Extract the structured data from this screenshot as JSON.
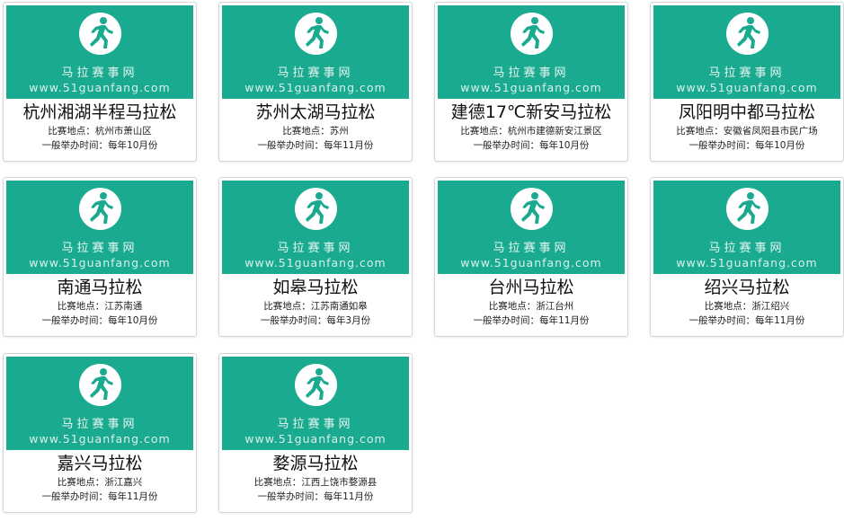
{
  "brand_watermark": "马拉赛事网",
  "brand_url": "www.51guanfang.com",
  "accent_color": "#1aaa90",
  "labels": {
    "location_prefix": "比赛地点：",
    "time_prefix": "一般举办时间：每年"
  },
  "events": [
    {
      "name": "杭州湘湖半程马拉松",
      "location": "杭州市萧山区",
      "month": "10月份"
    },
    {
      "name": "苏州太湖马拉松",
      "location": "苏州",
      "month": "11月份"
    },
    {
      "name": "建德17℃新安马拉松",
      "location": "杭州市建德新安江景区",
      "month": "10月份"
    },
    {
      "name": "凤阳明中都马拉松",
      "location": "安徽省凤阳县市民广场",
      "month": "10月份"
    },
    {
      "name": "南通马拉松",
      "location": "江苏南通",
      "month": "10月份"
    },
    {
      "name": "如皋马拉松",
      "location": "江苏南通如皋",
      "month": "3月份"
    },
    {
      "name": "台州马拉松",
      "location": "浙江台州",
      "month": "11月份"
    },
    {
      "name": "绍兴马拉松",
      "location": "浙江绍兴",
      "month": "11月份"
    },
    {
      "name": "嘉兴马拉松",
      "location": "浙江嘉兴",
      "month": "11月份"
    },
    {
      "name": "婺源马拉松",
      "location": "江西上饶市婺源县",
      "month": "11月份"
    }
  ],
  "icons": {
    "thumbnail": "runner-icon"
  }
}
